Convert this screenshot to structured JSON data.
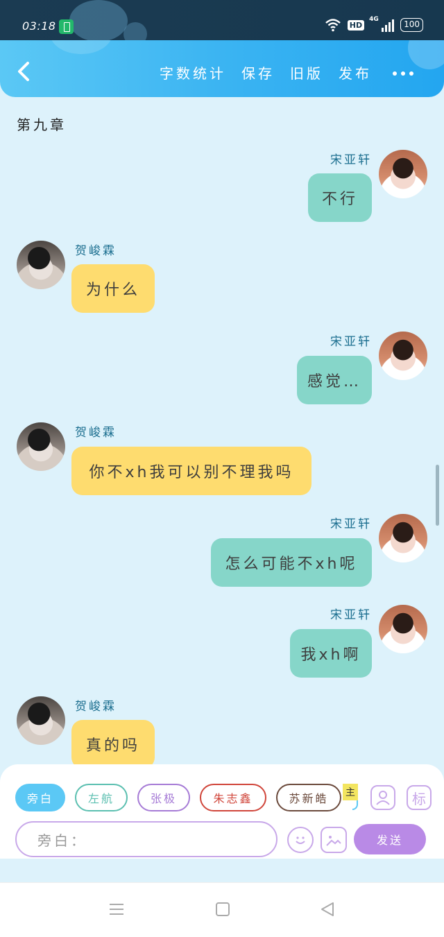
{
  "status_bar": {
    "time": "03:18",
    "hd": "HD",
    "network": "4G",
    "battery": "100"
  },
  "app_bar": {
    "menu": [
      {
        "label": "字数统计"
      },
      {
        "label": "保存"
      },
      {
        "label": "旧版"
      },
      {
        "label": "发布"
      }
    ]
  },
  "chapter": "第九章",
  "messages": [
    {
      "speaker": "宋亚轩",
      "text": "不行"
    },
    {
      "speaker": "贺峻霖",
      "text": "为什么"
    },
    {
      "speaker": "宋亚轩",
      "text": "感觉…"
    },
    {
      "speaker": "贺峻霖",
      "text": "你不xh我可以别不理我吗"
    },
    {
      "speaker": "宋亚轩",
      "text": "怎么可能不xh呢"
    },
    {
      "speaker": "宋亚轩",
      "text": "我xh啊"
    },
    {
      "speaker": "贺峻霖",
      "text": "真的吗"
    }
  ],
  "role_chips": [
    {
      "label": "旁白",
      "color": "#5bc8f5"
    },
    {
      "label": "左航",
      "color": "#5bbfb0"
    },
    {
      "label": "张极",
      "color": "#a67bd6"
    },
    {
      "label": "朱志鑫",
      "color": "#d0453a"
    },
    {
      "label": "苏新皓",
      "color": "#6b4a3c"
    }
  ],
  "main_tag": "主",
  "mark_button": "标",
  "input": {
    "placeholder": "旁白："
  },
  "send_label": "发送",
  "colors": {
    "accent": "#3bb4f2",
    "bubble_self": "#86d6c9",
    "bubble_other": "#fedc6f",
    "send": "#b98ae6"
  }
}
